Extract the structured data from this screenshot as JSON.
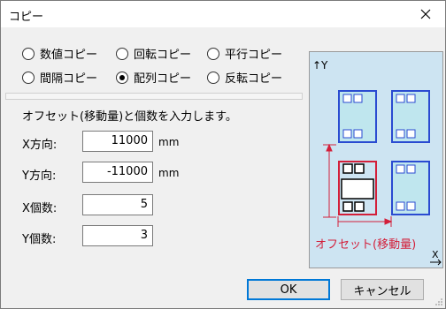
{
  "window": {
    "title": "コピー"
  },
  "radios": [
    {
      "label": "数値コピー",
      "selected": false
    },
    {
      "label": "回転コピー",
      "selected": false
    },
    {
      "label": "平行コピー",
      "selected": false
    },
    {
      "label": "間隔コピー",
      "selected": false
    },
    {
      "label": "配列コピー",
      "selected": true
    },
    {
      "label": "反転コピー",
      "selected": false
    }
  ],
  "instruction": "オフセット(移動量)と個数を入力します。",
  "fields": [
    {
      "label": "X方向:",
      "value": "11000",
      "unit": "mm"
    },
    {
      "label": "Y方向:",
      "value": "-11000",
      "unit": "mm"
    },
    {
      "label": "X個数:",
      "value": "5",
      "unit": ""
    },
    {
      "label": "Y個数:",
      "value": "3",
      "unit": ""
    }
  ],
  "preview": {
    "y_axis_label": "↑Y",
    "x_axis_label": "X",
    "offset_label": "オフセット(移動量)",
    "colors": {
      "bg": "#cde4f2",
      "blue": "#2a4bd1",
      "red": "#d31f3a",
      "cell": "#bfe6ee"
    }
  },
  "buttons": {
    "ok": "OK",
    "cancel": "キャンセル"
  }
}
